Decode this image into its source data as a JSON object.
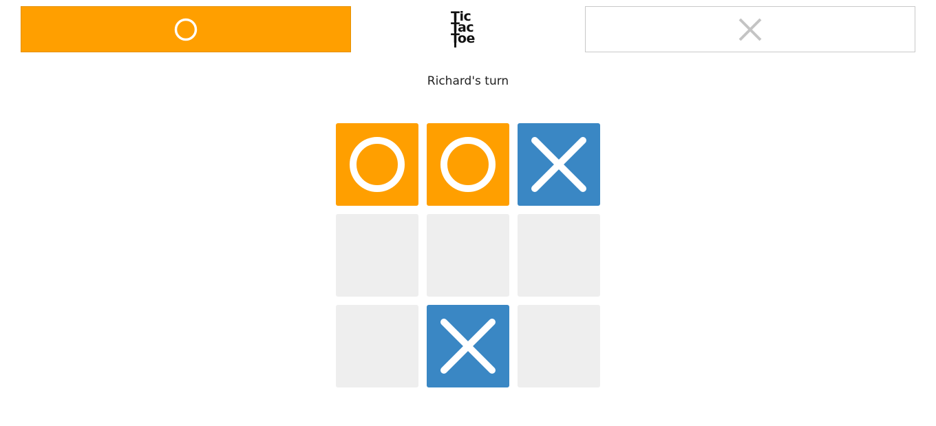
{
  "header": {
    "player_o": {
      "symbol": "O",
      "active": true,
      "color": "#ff9f00"
    },
    "player_x": {
      "symbol": "X",
      "active": false,
      "color": "#c4c4c4"
    },
    "logo": {
      "line1": "Tic",
      "line2": "Tac",
      "line3": "Toe"
    }
  },
  "status": {
    "text": "Richard's turn"
  },
  "board": {
    "cells": [
      "O",
      "O",
      "X",
      "",
      "",
      "",
      "",
      "X",
      ""
    ],
    "colors": {
      "o": "#ff9f00",
      "x": "#3a87c4",
      "empty": "#eeeeee"
    }
  }
}
